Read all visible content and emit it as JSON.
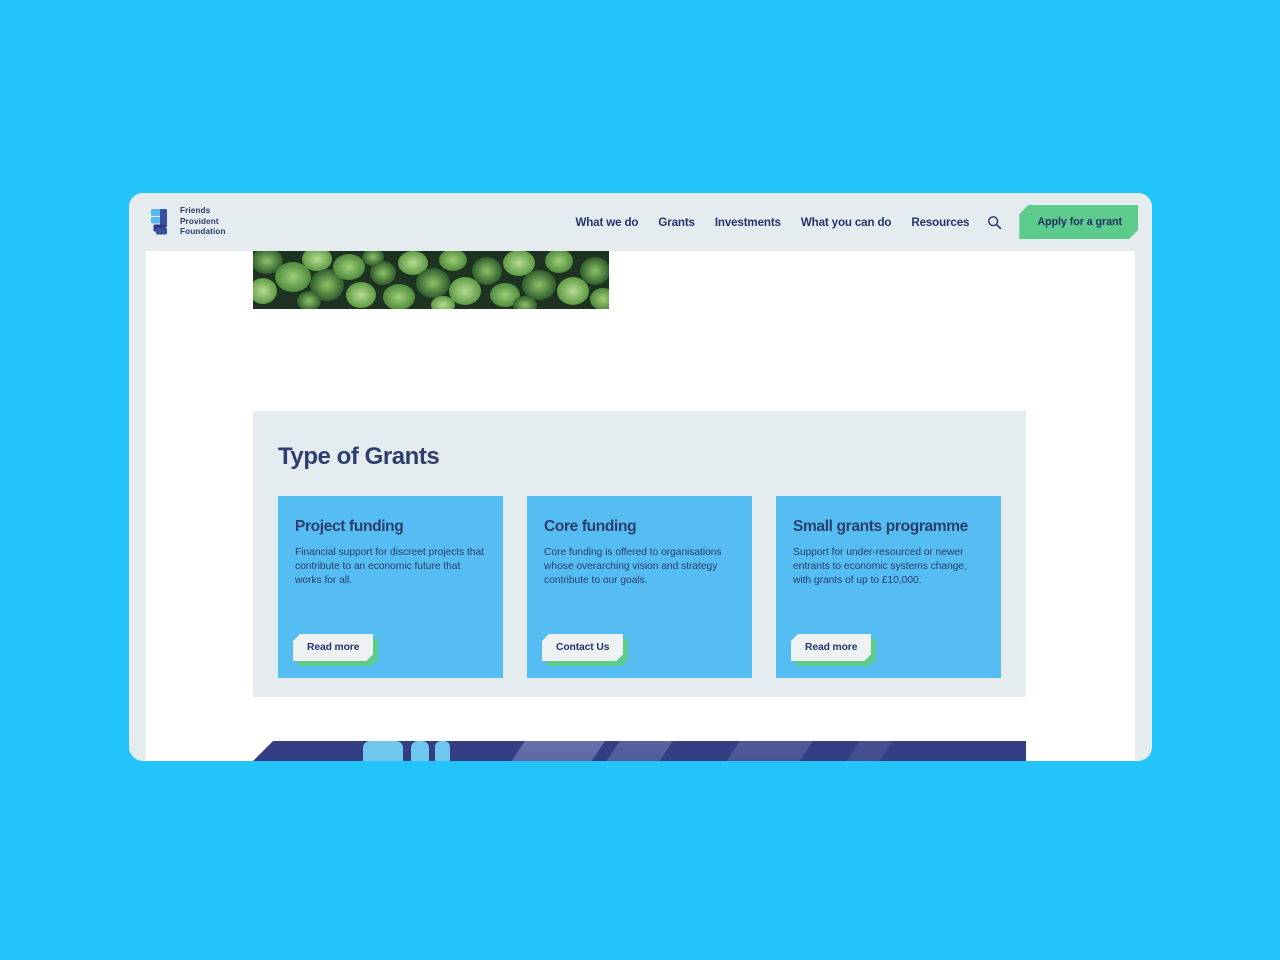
{
  "brand": {
    "logo_icon": "friends-provident-foundation-logo",
    "name_lines": [
      "Friends",
      "Provident",
      "Foundation"
    ],
    "navy": "#24356e",
    "green": "#5ccb8b",
    "card_blue": "#55bdf2",
    "page_bg": "#e5ecef",
    "backdrop": "#23c4fa"
  },
  "nav": {
    "items": [
      {
        "label": "What we do"
      },
      {
        "label": "Grants"
      },
      {
        "label": "Investments"
      },
      {
        "label": "What you can do"
      },
      {
        "label": "Resources"
      }
    ],
    "search_icon": "search-icon",
    "cta_label": "Apply for a grant"
  },
  "hero": {
    "image_alt": "aerial-forest-canopy-photograph"
  },
  "grants": {
    "section_title": "Type of Grants",
    "cards": [
      {
        "title": "Project funding",
        "body": "Financial support for discreet projects that contribute to an economic future that works for all.",
        "button_label": "Read more"
      },
      {
        "title": "Core funding",
        "body": "Core funding is offered to organisations whose overarching vision and strategy contribute to our goals.",
        "button_label": "Contact Us"
      },
      {
        "title": "Small grants programme",
        "body": "Support for under-resourced or newer entrants to economic systems change, with grants of up to £10,000.",
        "button_label": "Read more"
      }
    ]
  },
  "bottom_banner": {
    "image_alt": "illustration-of-people-walking-on-dark-blue-background-with-diagonal-stripes"
  }
}
